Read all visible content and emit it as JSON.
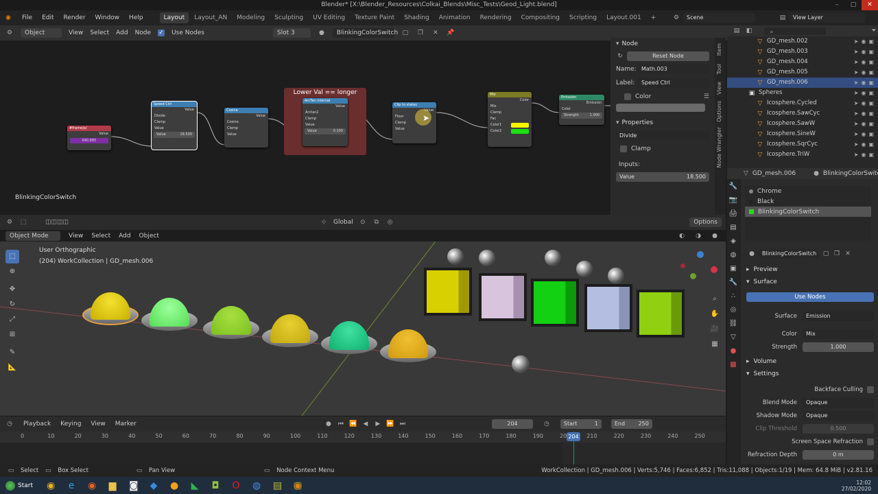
{
  "title": "Blender* [X:\\Blender_Resources\\Colkai_Blends\\Misc_Tests\\Geod_Light.blend]",
  "menus": [
    "File",
    "Edit",
    "Render",
    "Window",
    "Help"
  ],
  "workspaces": [
    "Layout",
    "Layout_AN",
    "Modeling",
    "Sculpting",
    "UV Editing",
    "Texture Paint",
    "Shading",
    "Animation",
    "Rendering",
    "Compositing",
    "Scripting",
    "Layout.001"
  ],
  "scene": "Scene",
  "view_layer": "View Layer",
  "node_editor": {
    "mode": "Object",
    "menus": [
      "View",
      "Select",
      "Add",
      "Node"
    ],
    "use_nodes": "Use Nodes",
    "slot": "Slot 3",
    "material": "BlinkingColorSwitch",
    "footer": "BlinkingColorSwitch",
    "frame_label": "Lower Val == longer",
    "nodes": {
      "frame": {
        "title": "#frame/p/",
        "value": "640.885",
        "out": "Value"
      },
      "speed": {
        "title": "Speed Ctrl",
        "out": "Value",
        "op": "Divide",
        "clamp": "Clamp",
        "in": "Value",
        "val_label": "Value",
        "val": "18.500"
      },
      "cosine": {
        "title": "Cosine",
        "out": "Value",
        "op": "Cosine",
        "clamp": "Clamp",
        "in": "Value"
      },
      "arctan": {
        "title": "ArcTan interval",
        "out": "Value",
        "op": "Arctan2",
        "clamp": "Clamp",
        "in": "Value",
        "val_label": "Value",
        "val": "0.100"
      },
      "clip": {
        "title": "Clip to states",
        "out": "Value",
        "op": "Floor",
        "clamp": "Clamp",
        "in": "Value"
      },
      "mix": {
        "title": "Mix",
        "out": "Color",
        "op": "Mix",
        "clamp": "Clamp",
        "fac": "Fac",
        "c1": "Color1",
        "c2": "Color2"
      },
      "emission": {
        "title": "Emission",
        "out": "Emission",
        "in": "Color",
        "strength_label": "Strength",
        "strength": "1.000"
      }
    }
  },
  "npanel": {
    "section": "Node",
    "reset": "Reset Node",
    "name_label": "Name:",
    "name": "Math.003",
    "label_label": "Label:",
    "label": "Speed Ctrl",
    "color": "Color",
    "properties": "Properties",
    "op": "Divide",
    "clamp": "Clamp",
    "inputs": "Inputs:",
    "value_label": "Value",
    "value": "18.500",
    "tabs": [
      "Item",
      "Tool",
      "View",
      "Options",
      "Node Wrangler"
    ]
  },
  "outliner": {
    "rows": [
      {
        "name": "GD_mesh.002",
        "sel": false
      },
      {
        "name": "GD_mesh.003",
        "sel": false
      },
      {
        "name": "GD_mesh.004",
        "sel": false
      },
      {
        "name": "GD_mesh.005",
        "sel": false
      },
      {
        "name": "GD_mesh.006",
        "sel": true
      },
      {
        "name": "Spheres",
        "sel": false,
        "collection": true
      },
      {
        "name": "Icosphere.Cycled",
        "sel": false
      },
      {
        "name": "Icosphere.SawCyc",
        "sel": false
      },
      {
        "name": "Icosphere.SawW",
        "sel": false
      },
      {
        "name": "Icosphere.SineW",
        "sel": false
      },
      {
        "name": "Icosphere.SqrCyc",
        "sel": false
      },
      {
        "name": "Icosphere.TriW",
        "sel": false
      }
    ]
  },
  "viewport": {
    "mode": "Object Mode",
    "menus": [
      "View",
      "Select",
      "Add",
      "Object"
    ],
    "orientation": "Global",
    "options": "Options",
    "view_name": "User Orthographic",
    "collection_info": "(204) WorkCollection | GD_mesh.006"
  },
  "properties": {
    "object": "GD_mesh.006",
    "material_header": "BlinkingColorSwitch",
    "slots": [
      "Chrome",
      "Black",
      "BlinkingColorSwitch"
    ],
    "material_field": "BlinkingColorSwitch",
    "preview": "Preview",
    "surface": "Surface",
    "use_nodes": "Use Nodes",
    "surface_label": "Surface",
    "surface_val": "Emission",
    "color_label": "Color",
    "color_val": "Mix",
    "strength_label": "Strength",
    "strength_val": "1.000",
    "volume": "Volume",
    "settings": "Settings",
    "backface": "Backface Culling",
    "blend_label": "Blend Mode",
    "blend_val": "Opaque",
    "shadow_label": "Shadow Mode",
    "shadow_val": "Opaque",
    "clip_label": "Clip Threshold",
    "clip_val": "0.500",
    "ssr": "Screen Space Refraction",
    "refr_label": "Refraction Depth",
    "refr_val": "0 m"
  },
  "timeline": {
    "menus": [
      "Playback",
      "Keying",
      "View",
      "Marker"
    ],
    "current": "204",
    "start_label": "Start",
    "start": "1",
    "end_label": "End",
    "end": "250",
    "ticks": [
      "0",
      "10",
      "20",
      "30",
      "40",
      "50",
      "60",
      "70",
      "80",
      "90",
      "100",
      "110",
      "120",
      "130",
      "140",
      "150",
      "160",
      "170",
      "180",
      "190",
      "200",
      "210",
      "220",
      "230",
      "240",
      "250"
    ],
    "playhead": "204"
  },
  "statusbar": {
    "select": "Select",
    "box": "Box Select",
    "pan": "Pan View",
    "ctx": "Node Context Menu",
    "info": "WorkCollection | GD_mesh.006 | Verts:5,746 | Faces:6,852 | Tris:11,088 | Objects:1/19 | Mem: 64.8 MiB | v2.81.16"
  },
  "taskbar": {
    "start": "Start",
    "time": "12:02",
    "date": "27/02/2020"
  }
}
